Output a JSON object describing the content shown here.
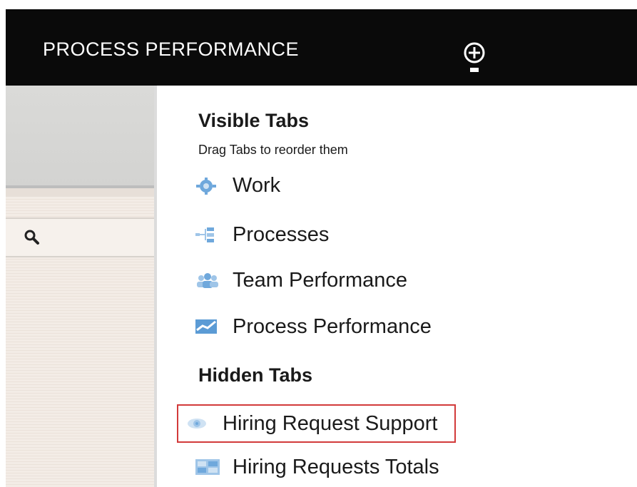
{
  "header": {
    "title": "PROCESS PERFORMANCE",
    "add_icon": "plus-circle-icon"
  },
  "sidebar": {
    "search_icon": "search-icon"
  },
  "menu": {
    "visible_title": "Visible Tabs",
    "visible_hint": "Drag Tabs to reorder them",
    "visible_items": [
      {
        "label": "Work",
        "icon": "gear-icon"
      },
      {
        "label": "Processes",
        "icon": "process-flow-icon"
      },
      {
        "label": "Team Performance",
        "icon": "team-icon"
      },
      {
        "label": "Process Performance",
        "icon": "chart-icon"
      }
    ],
    "hidden_title": "Hidden Tabs",
    "hidden_items": [
      {
        "label": "Hiring Request Support",
        "icon": "eye-icon",
        "highlighted": true
      },
      {
        "label": "Hiring Requests Totals",
        "icon": "dashboard-icon"
      }
    ]
  },
  "colors": {
    "header_bg": "#0a0a0a",
    "highlight_border": "#d23a3a",
    "icon_blue": "#5b9bd5"
  }
}
